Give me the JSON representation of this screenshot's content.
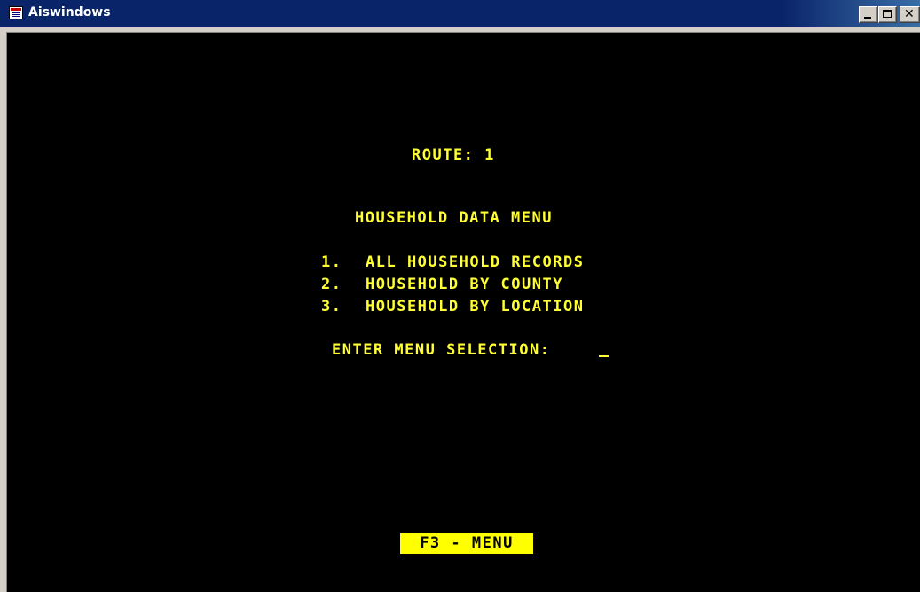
{
  "window": {
    "title": "Aiswindows",
    "controls": {
      "minimize_icon": "minimize-icon",
      "maximize_icon": "maximize-icon",
      "close_icon": "close-icon",
      "close_glyph": "✕"
    }
  },
  "terminal": {
    "route": "ROUTE: 1",
    "menu_title": "HOUSEHOLD DATA MENU",
    "options": [
      {
        "number": "1.",
        "label": "ALL HOUSEHOLD RECORDS"
      },
      {
        "number": "2.",
        "label": "HOUSEHOLD BY COUNTY"
      },
      {
        "number": "3.",
        "label": "HOUSEHOLD BY LOCATION"
      }
    ],
    "prompt": "ENTER MENU SELECTION:",
    "input_value": "",
    "function_key": "F3 - MENU"
  },
  "colors": {
    "background": "#000000",
    "text": "#ffff33",
    "function_key_bg": "#ffff00",
    "titlebar": "#0a246a"
  }
}
